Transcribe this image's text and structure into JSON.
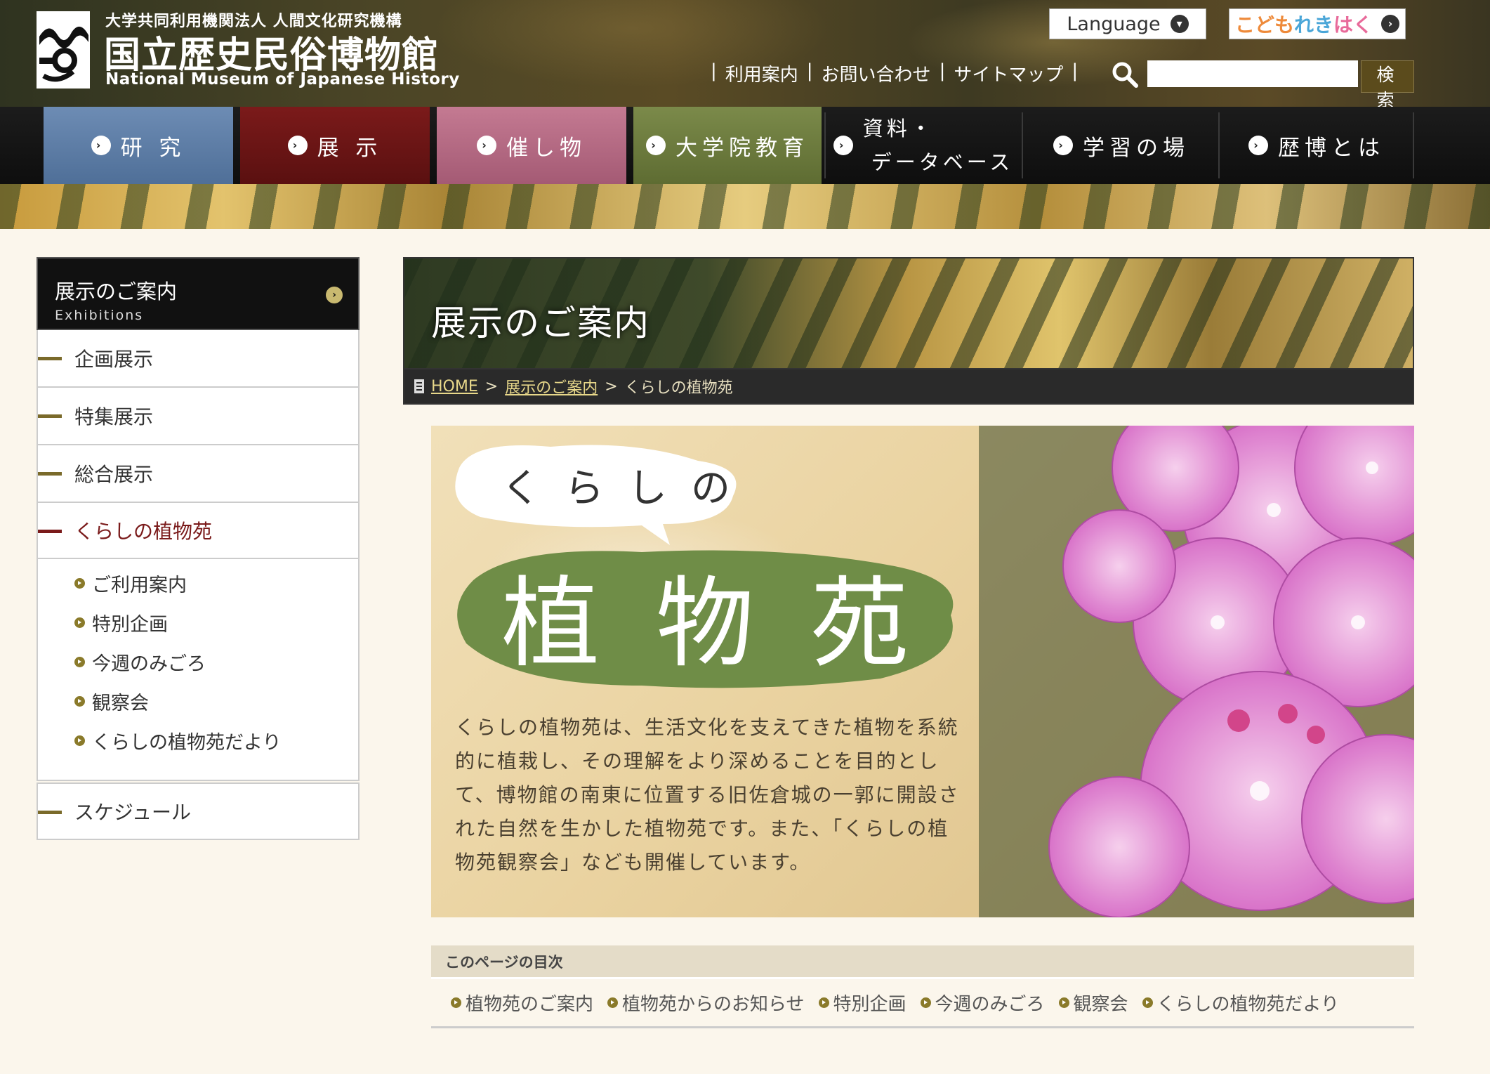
{
  "header": {
    "org_sub": "大学共同利用機関法人 人間文化研究機構",
    "org_name": "国立歴史民俗博物館",
    "org_en": "National Museum of Japanese History",
    "language_label": "Language",
    "kodomo": [
      "こども",
      "れき",
      "はく"
    ],
    "util_links": [
      "利用案内",
      "お問い合わせ",
      "サイトマップ"
    ],
    "search_button": "検 索"
  },
  "nav": [
    {
      "label": "研 究",
      "color": "#5a7aa3"
    },
    {
      "label": "展 示",
      "color": "#6e1616"
    },
    {
      "label": "催し物",
      "color": "#b96680"
    },
    {
      "label": "大学院教育",
      "color": "#6b7a3e"
    },
    {
      "label1": "資料・",
      "label2": "データベース"
    },
    {
      "label": "学習の場"
    },
    {
      "label": "歴博とは"
    }
  ],
  "sidebar": {
    "head_jp": "展示のご案内",
    "head_en": "Exhibitions",
    "items": [
      "企画展示",
      "特集展示",
      "総合展示",
      "くらしの植物苑"
    ],
    "sub_items": [
      "ご利用案内",
      "特別企画",
      "今週のみごろ",
      "観察会",
      "くらしの植物苑だより"
    ],
    "last_item": "スケジュール"
  },
  "main": {
    "banner_title": "展示のご案内",
    "breadcrumb": [
      "HOME",
      "展示のご案内",
      "くらしの植物苑"
    ],
    "feature_heading_small": "くらしの",
    "feature_heading_big": "植物苑",
    "feature_description": "くらしの植物苑は、生活文化を支えてきた植物を系統的に植栽し、その理解をより深めることを目的として、博物館の南東に位置する旧佐倉城の一郭に開設された自然を生かした植物苑です。また、「くらしの植物苑観察会」なども開催しています。"
  },
  "toc": {
    "heading": "このページの目次",
    "items": [
      "植物苑のご案内",
      "植物苑からのお知らせ",
      "特別企画",
      "今週のみごろ",
      "観察会",
      "くらしの植物苑だより"
    ]
  }
}
